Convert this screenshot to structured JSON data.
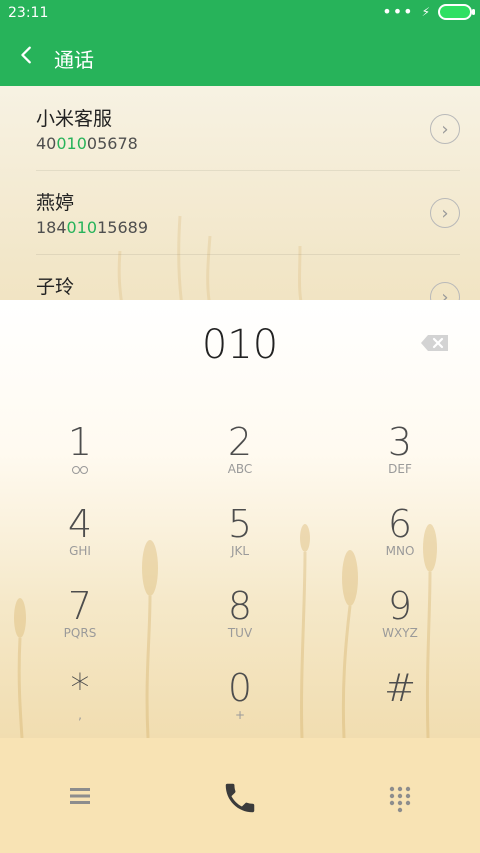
{
  "status": {
    "time": "23:11"
  },
  "header": {
    "title": "通话"
  },
  "results": [
    {
      "name": "小米客服",
      "number_pre": "40",
      "number_match": "010",
      "number_post": "05678"
    },
    {
      "name": "燕婷",
      "number_pre": "184",
      "number_match": "010",
      "number_post": "15689"
    },
    {
      "name": "子玲"
    }
  ],
  "dialer": {
    "entered": "010",
    "keys": [
      {
        "digit": "1",
        "sub": ""
      },
      {
        "digit": "2",
        "sub": "ABC"
      },
      {
        "digit": "3",
        "sub": "DEF"
      },
      {
        "digit": "4",
        "sub": "GHI"
      },
      {
        "digit": "5",
        "sub": "JKL"
      },
      {
        "digit": "6",
        "sub": "MNO"
      },
      {
        "digit": "7",
        "sub": "PQRS"
      },
      {
        "digit": "8",
        "sub": "TUV"
      },
      {
        "digit": "9",
        "sub": "WXYZ"
      },
      {
        "digit": "*",
        "sub": ","
      },
      {
        "digit": "0",
        "sub": "+"
      },
      {
        "digit": "#",
        "sub": ""
      }
    ]
  },
  "colors": {
    "accent": "#27b35a",
    "bottom_bar": "#f8e3b4"
  },
  "icons": {
    "back": "chevron-left-icon",
    "delete": "backspace-icon",
    "menu": "menu-icon",
    "call": "phone-icon",
    "keypad": "keypad-icon"
  }
}
